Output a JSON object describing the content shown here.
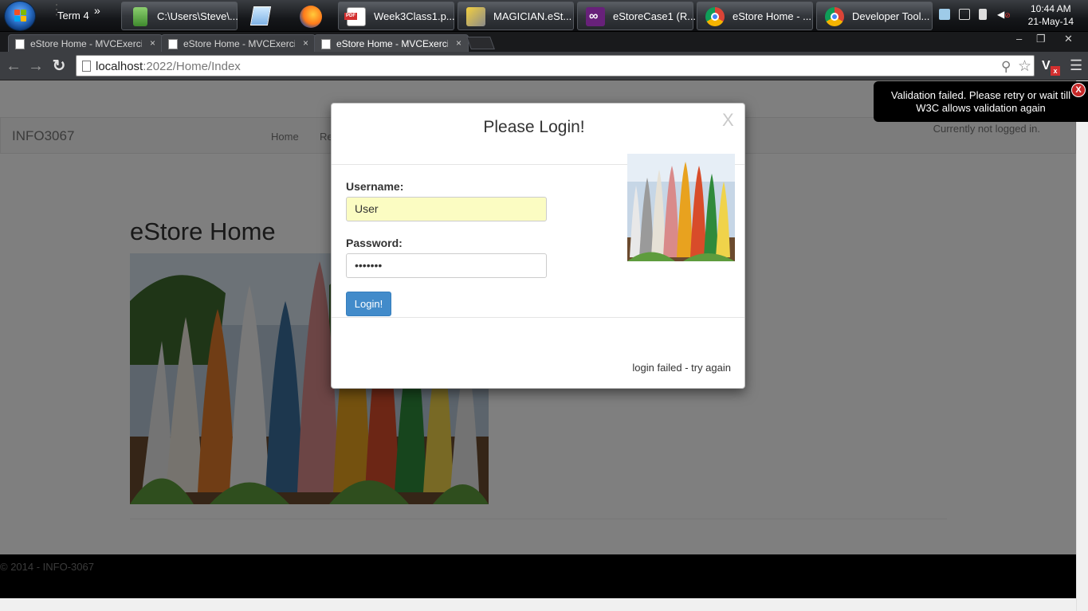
{
  "taskbar": {
    "toolbar_label": "Term 4",
    "toolbar_chevron": "»",
    "items": [
      {
        "label": "C:\\Users\\Steve\\...",
        "icon": "explorer-icon",
        "color": "#6ab04c"
      },
      {
        "label": "Week3Class1.p...",
        "icon": "pdf-icon",
        "color": "#d32f2f"
      },
      {
        "label": "MAGICIAN.eSt...",
        "icon": "tools-icon",
        "color": "#c9a227"
      },
      {
        "label": "eStoreCase1 (R...",
        "icon": "visual-studio-icon",
        "color": "#68217a"
      },
      {
        "label": "eStore Home - ...",
        "icon": "chrome-icon",
        "color": "#e8b530"
      },
      {
        "label": "Developer Tool...",
        "icon": "chrome-icon",
        "color": "#e8b530"
      }
    ],
    "clock": {
      "time": "10:44 AM",
      "date": "21-May-14"
    }
  },
  "browser": {
    "tabs": [
      {
        "label": "eStore Home - MVCExerci",
        "close": "×"
      },
      {
        "label": "eStore Home - MVCExerci",
        "close": "×"
      },
      {
        "label": "eStore Home - MVCExerci",
        "close": "×"
      }
    ],
    "window_controls": [
      "–",
      "❐",
      "✕"
    ],
    "url_host": "localhost",
    "url_rest": ":2022/Home/Index"
  },
  "page": {
    "brand": "INFO3067",
    "nav": [
      "Home",
      "Re"
    ],
    "login_status": "Currently not logged in.",
    "heading": "eStore Home",
    "footer": "© 2014 - INFO-3067"
  },
  "modal": {
    "title": "Please Login!",
    "close": "X",
    "username_label": "Username:",
    "username_value": "User",
    "password_label": "Password:",
    "password_value": "•••••••",
    "login_button": "Login!",
    "message": "login failed - try again"
  },
  "toast": {
    "text": "Validation failed. Please retry or wait till W3C allows validation again",
    "close": "X"
  }
}
